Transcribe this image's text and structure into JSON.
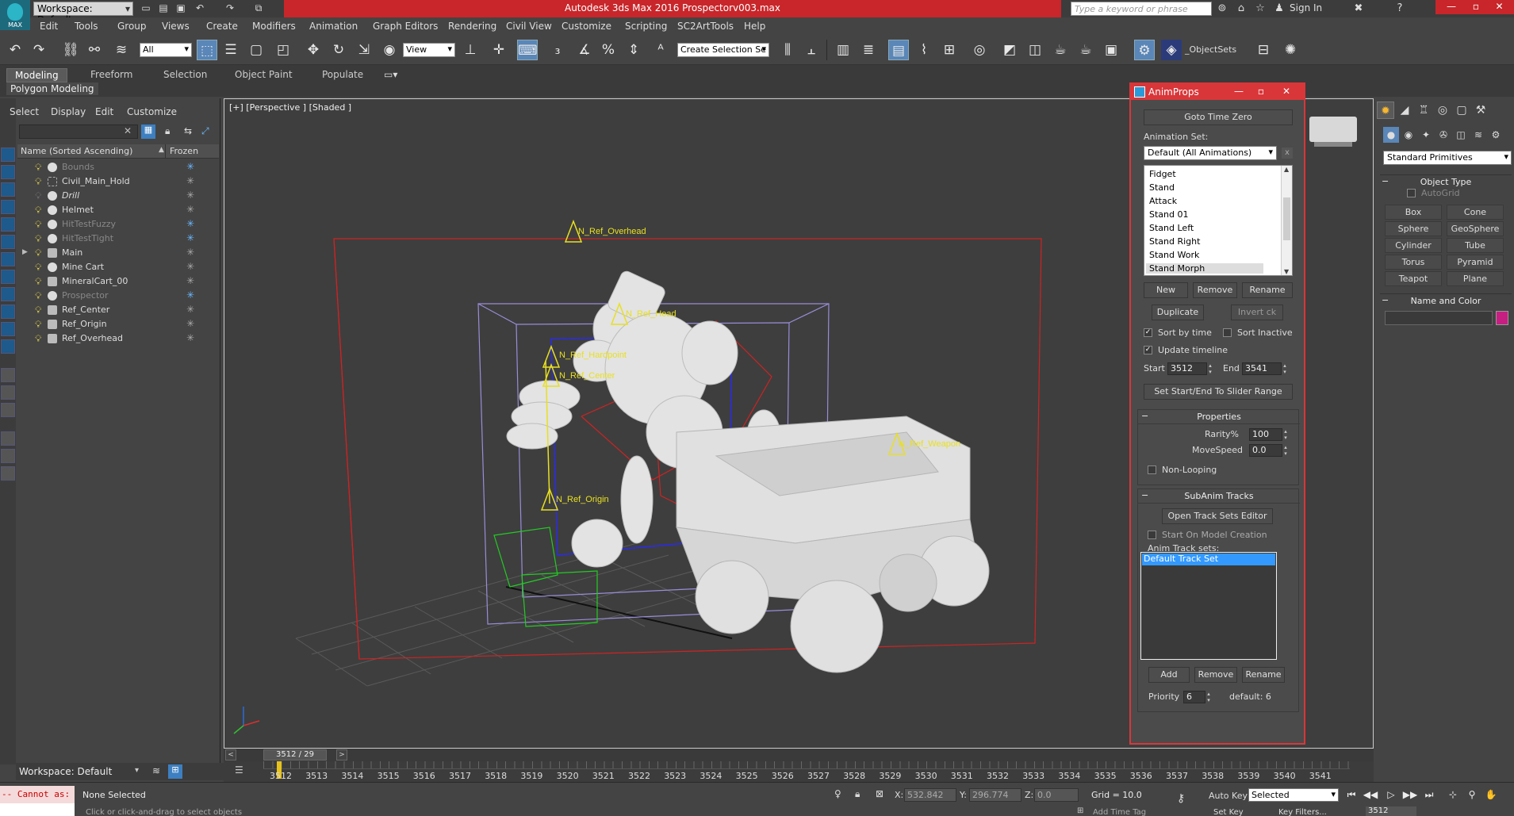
{
  "titlebar": {
    "logo_label": "MAX",
    "workspace": "Workspace: Default",
    "title": "Autodesk 3ds Max 2016     Prospectorv003.max",
    "search_placeholder": "Type a keyword or phrase",
    "sign_in": "Sign In"
  },
  "menu": [
    "Edit",
    "Tools",
    "Group",
    "Views",
    "Create",
    "Modifiers",
    "Animation",
    "Graph Editors",
    "Rendering",
    "Civil View",
    "Customize",
    "Scripting",
    "SC2ArtTools",
    "Help"
  ],
  "toolbar": {
    "selection_filter": "All",
    "ref_coord": "View",
    "named_selection": "Create Selection Se",
    "object_sets": "_ObjectSets"
  },
  "ribbon": {
    "tabs": [
      "Modeling",
      "Freeform",
      "Selection",
      "Object Paint",
      "Populate"
    ],
    "subtitle": "Polygon Modeling"
  },
  "scene_explorer": {
    "menus": [
      "Select",
      "Display",
      "Edit",
      "Customize"
    ],
    "col_name": "Name (Sorted Ascending)",
    "col_frozen": "Frozen",
    "rows": [
      {
        "name": "Bounds"
      },
      {
        "name": "Civil_Main_Hold"
      },
      {
        "name": "Drill"
      },
      {
        "name": "Helmet"
      },
      {
        "name": "HitTestFuzzy"
      },
      {
        "name": "HitTestTight"
      },
      {
        "name": "Main"
      },
      {
        "name": "Mine Cart"
      },
      {
        "name": "MineralCart_00"
      },
      {
        "name": "Prospector"
      },
      {
        "name": "Ref_Center"
      },
      {
        "name": "Ref_Origin"
      },
      {
        "name": "Ref_Overhead"
      }
    ],
    "workspace": "Workspace: Default"
  },
  "viewport": {
    "label": "[+] [Perspective ] [Shaded ]",
    "helpers": [
      "N_Ref_Overhead",
      "N_Ref_Head",
      "N_Ref_Hardpoint",
      "N_Ref_Center",
      "N_Ref_Weapon",
      "N_Ref_Origin"
    ]
  },
  "animprops": {
    "title": "AnimProps",
    "goto_time_zero": "Goto Time Zero",
    "anim_set_label": "Animation Set:",
    "anim_set_value": "Default (All Animations)",
    "anim_set_clear": "x",
    "animations": [
      "Fidget",
      "Stand",
      "Attack",
      "Stand 01",
      "Stand Left",
      "Stand Right",
      "Stand Work",
      "Stand Morph"
    ],
    "btn_new": "New",
    "btn_remove": "Remove",
    "btn_rename": "Rename",
    "btn_duplicate": "Duplicate",
    "btn_invert": "Invert ck",
    "sort_by_time": "Sort by time",
    "sort_inactive": "Sort Inactive",
    "update_timeline": "Update timeline",
    "start_label": "Start",
    "start_value": "3512",
    "end_label": "End",
    "end_value": "3541",
    "set_slider_range": "Set Start/End To Slider Range",
    "properties_title": "Properties",
    "rarity_label": "Rarity%",
    "rarity_value": "100",
    "movespeed_label": "MoveSpeed",
    "movespeed_value": "0.0",
    "non_looping": "Non-Looping",
    "subanim_title": "SubAnim Tracks",
    "open_track_editor": "Open Track Sets Editor",
    "start_on_creation": "Start On Model Creation",
    "track_sets_label": "Anim Track sets:",
    "track_sets": [
      "Default Track Set"
    ],
    "btn_add": "Add",
    "priority_label": "Priority",
    "priority_value": "6",
    "default_label": "default: 6"
  },
  "command_panel": {
    "category": "Standard Primitives",
    "object_type_title": "Object Type",
    "autogrid": "AutoGrid",
    "buttons": [
      "Box",
      "Cone",
      "Sphere",
      "GeoSphere",
      "Cylinder",
      "Tube",
      "Torus",
      "Pyramid",
      "Teapot",
      "Plane"
    ],
    "name_color_title": "Name and Color",
    "object_color": "#c71e82"
  },
  "timeline": {
    "slider_text": "3512 / 29",
    "ticks": [
      "3512",
      "3513",
      "3514",
      "3515",
      "3516",
      "3517",
      "3518",
      "3519",
      "3520",
      "3521",
      "3522",
      "3523",
      "3524",
      "3525",
      "3526",
      "3527",
      "3528",
      "3529",
      "3530",
      "3531",
      "3532",
      "3533",
      "3534",
      "3535",
      "3536",
      "3537",
      "3538",
      "3539",
      "3540",
      "3541"
    ]
  },
  "statusbar": {
    "maxscript": "-- Cannot as:",
    "selection": "None Selected",
    "prompt": "Click or click-and-drag to select objects",
    "x_label": "X:",
    "x_value": "532.842",
    "y_label": "Y:",
    "y_value": "296.774",
    "z_label": "Z:",
    "z_value": "0.0",
    "grid": "Grid = 10.0",
    "add_time_tag": "Add Time Tag",
    "auto_key": "Auto Key",
    "set_key": "Set Key",
    "key_mode": "Selected",
    "key_filters": "Key Filters...",
    "current_frame": "3512"
  }
}
